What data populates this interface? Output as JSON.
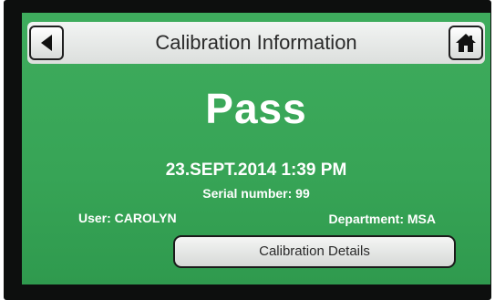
{
  "header": {
    "title": "Calibration Information",
    "back_icon": "back-arrow-icon",
    "home_icon": "home-icon"
  },
  "result": {
    "status": "Pass",
    "datetime": "23.SEPT.2014 1:39 PM",
    "serial": "Serial number: 99",
    "user": "User: CAROLYN",
    "department": "Department: MSA"
  },
  "actions": {
    "details_label": "Calibration Details"
  },
  "colors": {
    "screen_background": "#3aa75a",
    "bezel": "#0d0f0e",
    "button_face": "#e6e8e7",
    "text_on_green": "#ffffff"
  }
}
